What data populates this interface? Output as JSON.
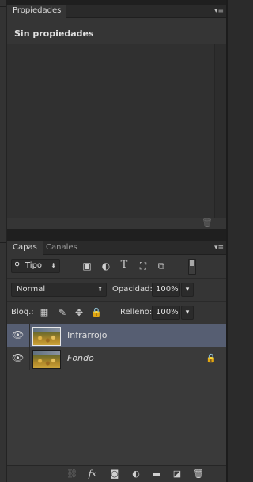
{
  "propiedades_panel": {
    "tab_label": "Propiedades",
    "menu_icon": "panel-menu-icon",
    "empty_text": "Sin propiedades",
    "footer_icon": "trash-icon"
  },
  "capas_panel": {
    "tabs": [
      {
        "label": "Capas",
        "active": true
      },
      {
        "label": "Canales",
        "active": false
      }
    ],
    "menu_icon": "panel-menu-icon",
    "filter": {
      "search_icon": "search-icon",
      "kind_value": "Tipo",
      "filter_icons": [
        "image-filter-icon",
        "adjustment-filter-icon",
        "type-filter-icon",
        "shape-filter-icon",
        "smart-object-filter-icon"
      ]
    },
    "blend_mode": "Normal",
    "opacity_label": "Opacidad:",
    "opacity_value": "100%",
    "lock_label": "Bloq.:",
    "lock_icons": [
      "lock-transparent-icon",
      "lock-image-icon",
      "lock-position-icon",
      "lock-all-icon"
    ],
    "fill_label": "Relleno:",
    "fill_value": "100%",
    "layers": [
      {
        "name": "Infrarrojo",
        "visible": true,
        "selected": true,
        "locked": false,
        "italic": false
      },
      {
        "name": "Fondo",
        "visible": true,
        "selected": false,
        "locked": true,
        "italic": true
      }
    ],
    "footer_icons": [
      "link-layers-icon",
      "fx-icon",
      "add-mask-icon",
      "adjustment-layer-icon",
      "group-folder-icon",
      "new-layer-icon",
      "trash-icon"
    ],
    "fx_label": "fx"
  },
  "colors": {
    "panel_bg": "#353535",
    "selected_layer": "#565e72",
    "tab_bar": "#2a2a2a"
  }
}
